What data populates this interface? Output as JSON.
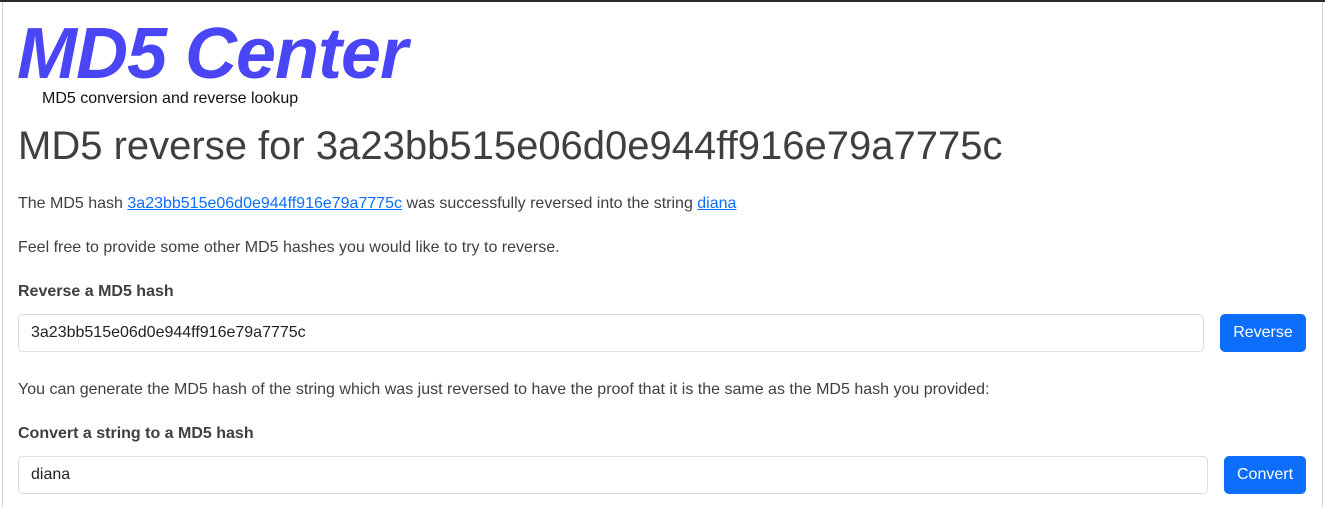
{
  "site": {
    "brand": "MD5 Center",
    "tagline": "MD5 conversion and reverse lookup"
  },
  "page": {
    "heading": "MD5 reverse for 3a23bb515e06d0e944ff916e79a7775c"
  },
  "result": {
    "prefix": "The MD5 hash ",
    "hash_link": "3a23bb515e06d0e944ff916e79a7775c",
    "middle": " was successfully reversed into the string ",
    "string_link": "diana"
  },
  "invite_text": "Feel free to provide some other MD5 hashes you would like to try to reverse.",
  "reverse_form": {
    "label": "Reverse a MD5 hash",
    "value": "3a23bb515e06d0e944ff916e79a7775c",
    "button": "Reverse"
  },
  "proof_text": "You can generate the MD5 hash of the string which was just reversed to have the proof that it is the same as the MD5 hash you provided:",
  "convert_form": {
    "label": "Convert a string to a MD5 hash",
    "value": "diana",
    "button": "Convert"
  }
}
